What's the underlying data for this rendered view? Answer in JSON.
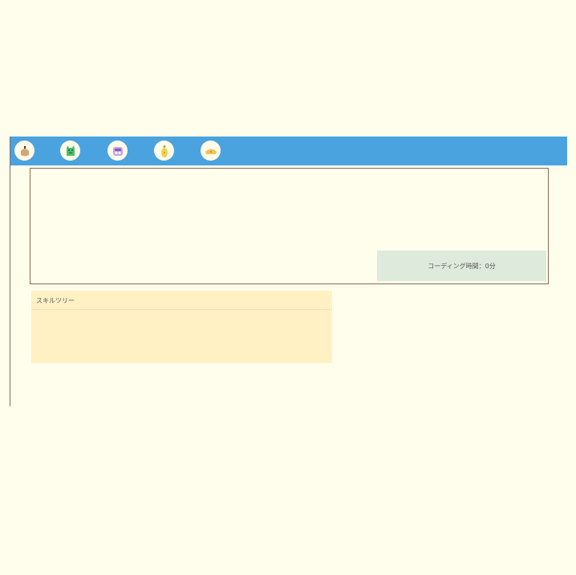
{
  "navbar": {
    "color": "#4aa3df",
    "icons": [
      {
        "name": "acorn-icon"
      },
      {
        "name": "frog-icon"
      },
      {
        "name": "robot-icon"
      },
      {
        "name": "pineapple-icon"
      },
      {
        "name": "bread-icon"
      }
    ]
  },
  "main": {
    "coding_time_label": "コーディング時間：0分"
  },
  "skill_tree": {
    "title": "スキルツリー"
  }
}
